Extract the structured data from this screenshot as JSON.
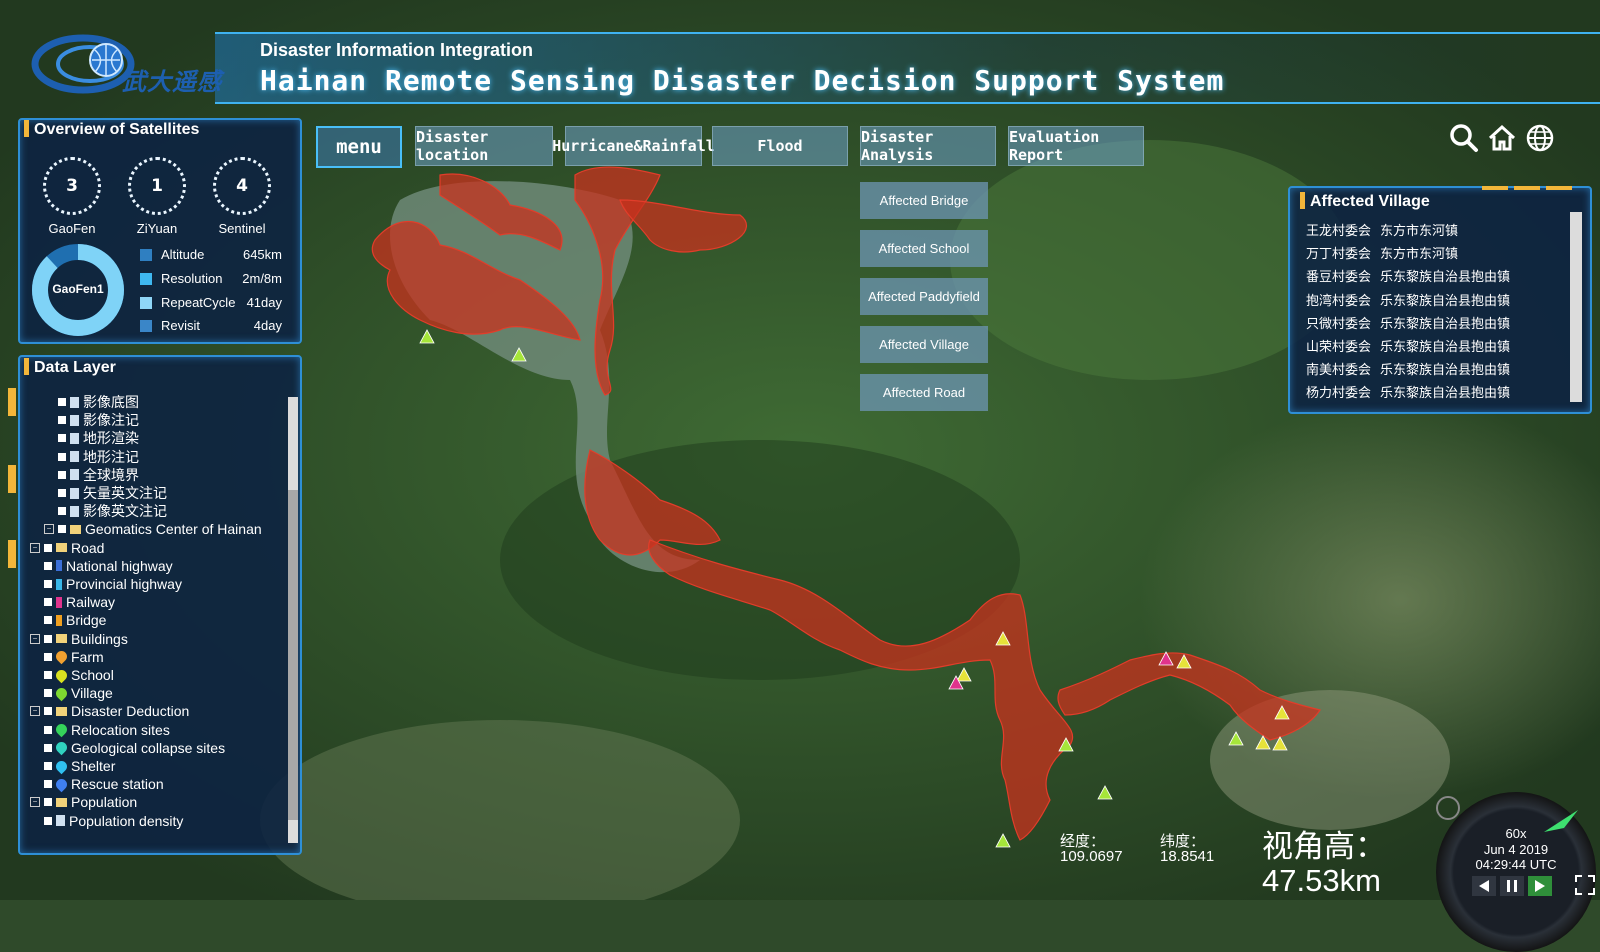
{
  "header": {
    "logo_text": "武大遥感",
    "subtitle": "Disaster Information Integration",
    "title": "Hainan Remote Sensing Disaster Decision Support System"
  },
  "nav": {
    "menu_label": "menu",
    "tabs": [
      "Disaster location",
      "Hurricane&Rainfall",
      "Flood",
      "Disaster Analysis",
      "Evaluation Report"
    ],
    "submenu": [
      "Affected Bridge",
      "Affected School",
      "Affected Paddyfield",
      "Affected Village",
      "Affected Road"
    ]
  },
  "tools": [
    "search-icon",
    "home-icon",
    "globe-icon"
  ],
  "satellites": {
    "title": "Overview of Satellites",
    "counts": [
      {
        "name": "GaoFen",
        "count": "3"
      },
      {
        "name": "ZiYuan",
        "count": "1"
      },
      {
        "name": "Sentinel",
        "count": "4"
      }
    ],
    "donut_label": "GaoFen1",
    "stats": [
      {
        "label": "Altitude",
        "value": "645km",
        "color": "#2f7fc1"
      },
      {
        "label": "Resolution",
        "value": "2m/8m",
        "color": "#3fb8f0"
      },
      {
        "label": "RepeatCycle",
        "value": "41day",
        "color": "#8fd6f7"
      },
      {
        "label": "Revisit",
        "value": "4day",
        "color": "#3a86c8"
      }
    ]
  },
  "data_layer": {
    "title": "Data Layer",
    "items": [
      {
        "text": "影像底图",
        "level": 3,
        "kind": "file"
      },
      {
        "text": "影像注记",
        "level": 3,
        "kind": "file"
      },
      {
        "text": "地形渲染",
        "level": 3,
        "kind": "file"
      },
      {
        "text": "地形注记",
        "level": 3,
        "kind": "file"
      },
      {
        "text": "全球境界",
        "level": 3,
        "kind": "file"
      },
      {
        "text": "矢量英文注记",
        "level": 3,
        "kind": "file"
      },
      {
        "text": "影像英文注记",
        "level": 3,
        "kind": "file"
      },
      {
        "text": "Geomatics Center of Hainan",
        "level": 2,
        "kind": "folder"
      },
      {
        "text": "Road",
        "level": 1,
        "kind": "folder"
      },
      {
        "text": "National highway",
        "level": 2,
        "kind": "line",
        "color": "#3b6fd8"
      },
      {
        "text": "Provincial highway",
        "level": 2,
        "kind": "line",
        "color": "#38b6e8"
      },
      {
        "text": "Railway",
        "level": 2,
        "kind": "line",
        "color": "#e0338c"
      },
      {
        "text": "Bridge",
        "level": 2,
        "kind": "line",
        "color": "#f0a020"
      },
      {
        "text": "Buildings",
        "level": 1,
        "kind": "folder"
      },
      {
        "text": "Farm",
        "level": 2,
        "kind": "pin",
        "color": "#f0a030"
      },
      {
        "text": "School",
        "level": 2,
        "kind": "pin",
        "color": "#d8e020"
      },
      {
        "text": "Village",
        "level": 2,
        "kind": "pin",
        "color": "#7ed830"
      },
      {
        "text": "Disaster Deduction",
        "level": 1,
        "kind": "folder"
      },
      {
        "text": "Relocation sites",
        "level": 2,
        "kind": "pin",
        "color": "#34d25a"
      },
      {
        "text": "Geological collapse sites",
        "level": 2,
        "kind": "pin",
        "color": "#30d2c0"
      },
      {
        "text": "Shelter",
        "level": 2,
        "kind": "pin",
        "color": "#30c0f0"
      },
      {
        "text": "Rescue station",
        "level": 2,
        "kind": "pin",
        "color": "#3f7ff0"
      },
      {
        "text": "Population",
        "level": 1,
        "kind": "folder"
      },
      {
        "text": "Population density",
        "level": 2,
        "kind": "file"
      }
    ]
  },
  "affected_village": {
    "title": "Affected Village",
    "rows": [
      {
        "village": "王龙村委会",
        "town": "东方市东河镇"
      },
      {
        "village": "万丁村委会",
        "town": "东方市东河镇"
      },
      {
        "village": "番豆村委会",
        "town": "乐东黎族自治县抱由镇"
      },
      {
        "village": "抱湾村委会",
        "town": "乐东黎族自治县抱由镇"
      },
      {
        "village": "只微村委会",
        "town": "乐东黎族自治县抱由镇"
      },
      {
        "village": "山荣村委会",
        "town": "乐东黎族自治县抱由镇"
      },
      {
        "village": "南美村委会",
        "town": "乐东黎族自治县抱由镇"
      },
      {
        "village": "杨力村委会",
        "town": "乐东黎族自治县抱由镇"
      }
    ]
  },
  "status": {
    "lon_label": "经度：",
    "lon_value": "109.0697",
    "lat_label": "纬度：",
    "lat_value": "18.8541",
    "view_height_label": "视角高：",
    "view_height_value": "47.53km"
  },
  "clock": {
    "speed": "60x",
    "date": "Jun 4 2019",
    "time": "04:29:44 UTC"
  },
  "colors": {
    "accent": "#2e8fd6",
    "flood": "#c8321e",
    "marker_highlight": "#f3b63a"
  }
}
